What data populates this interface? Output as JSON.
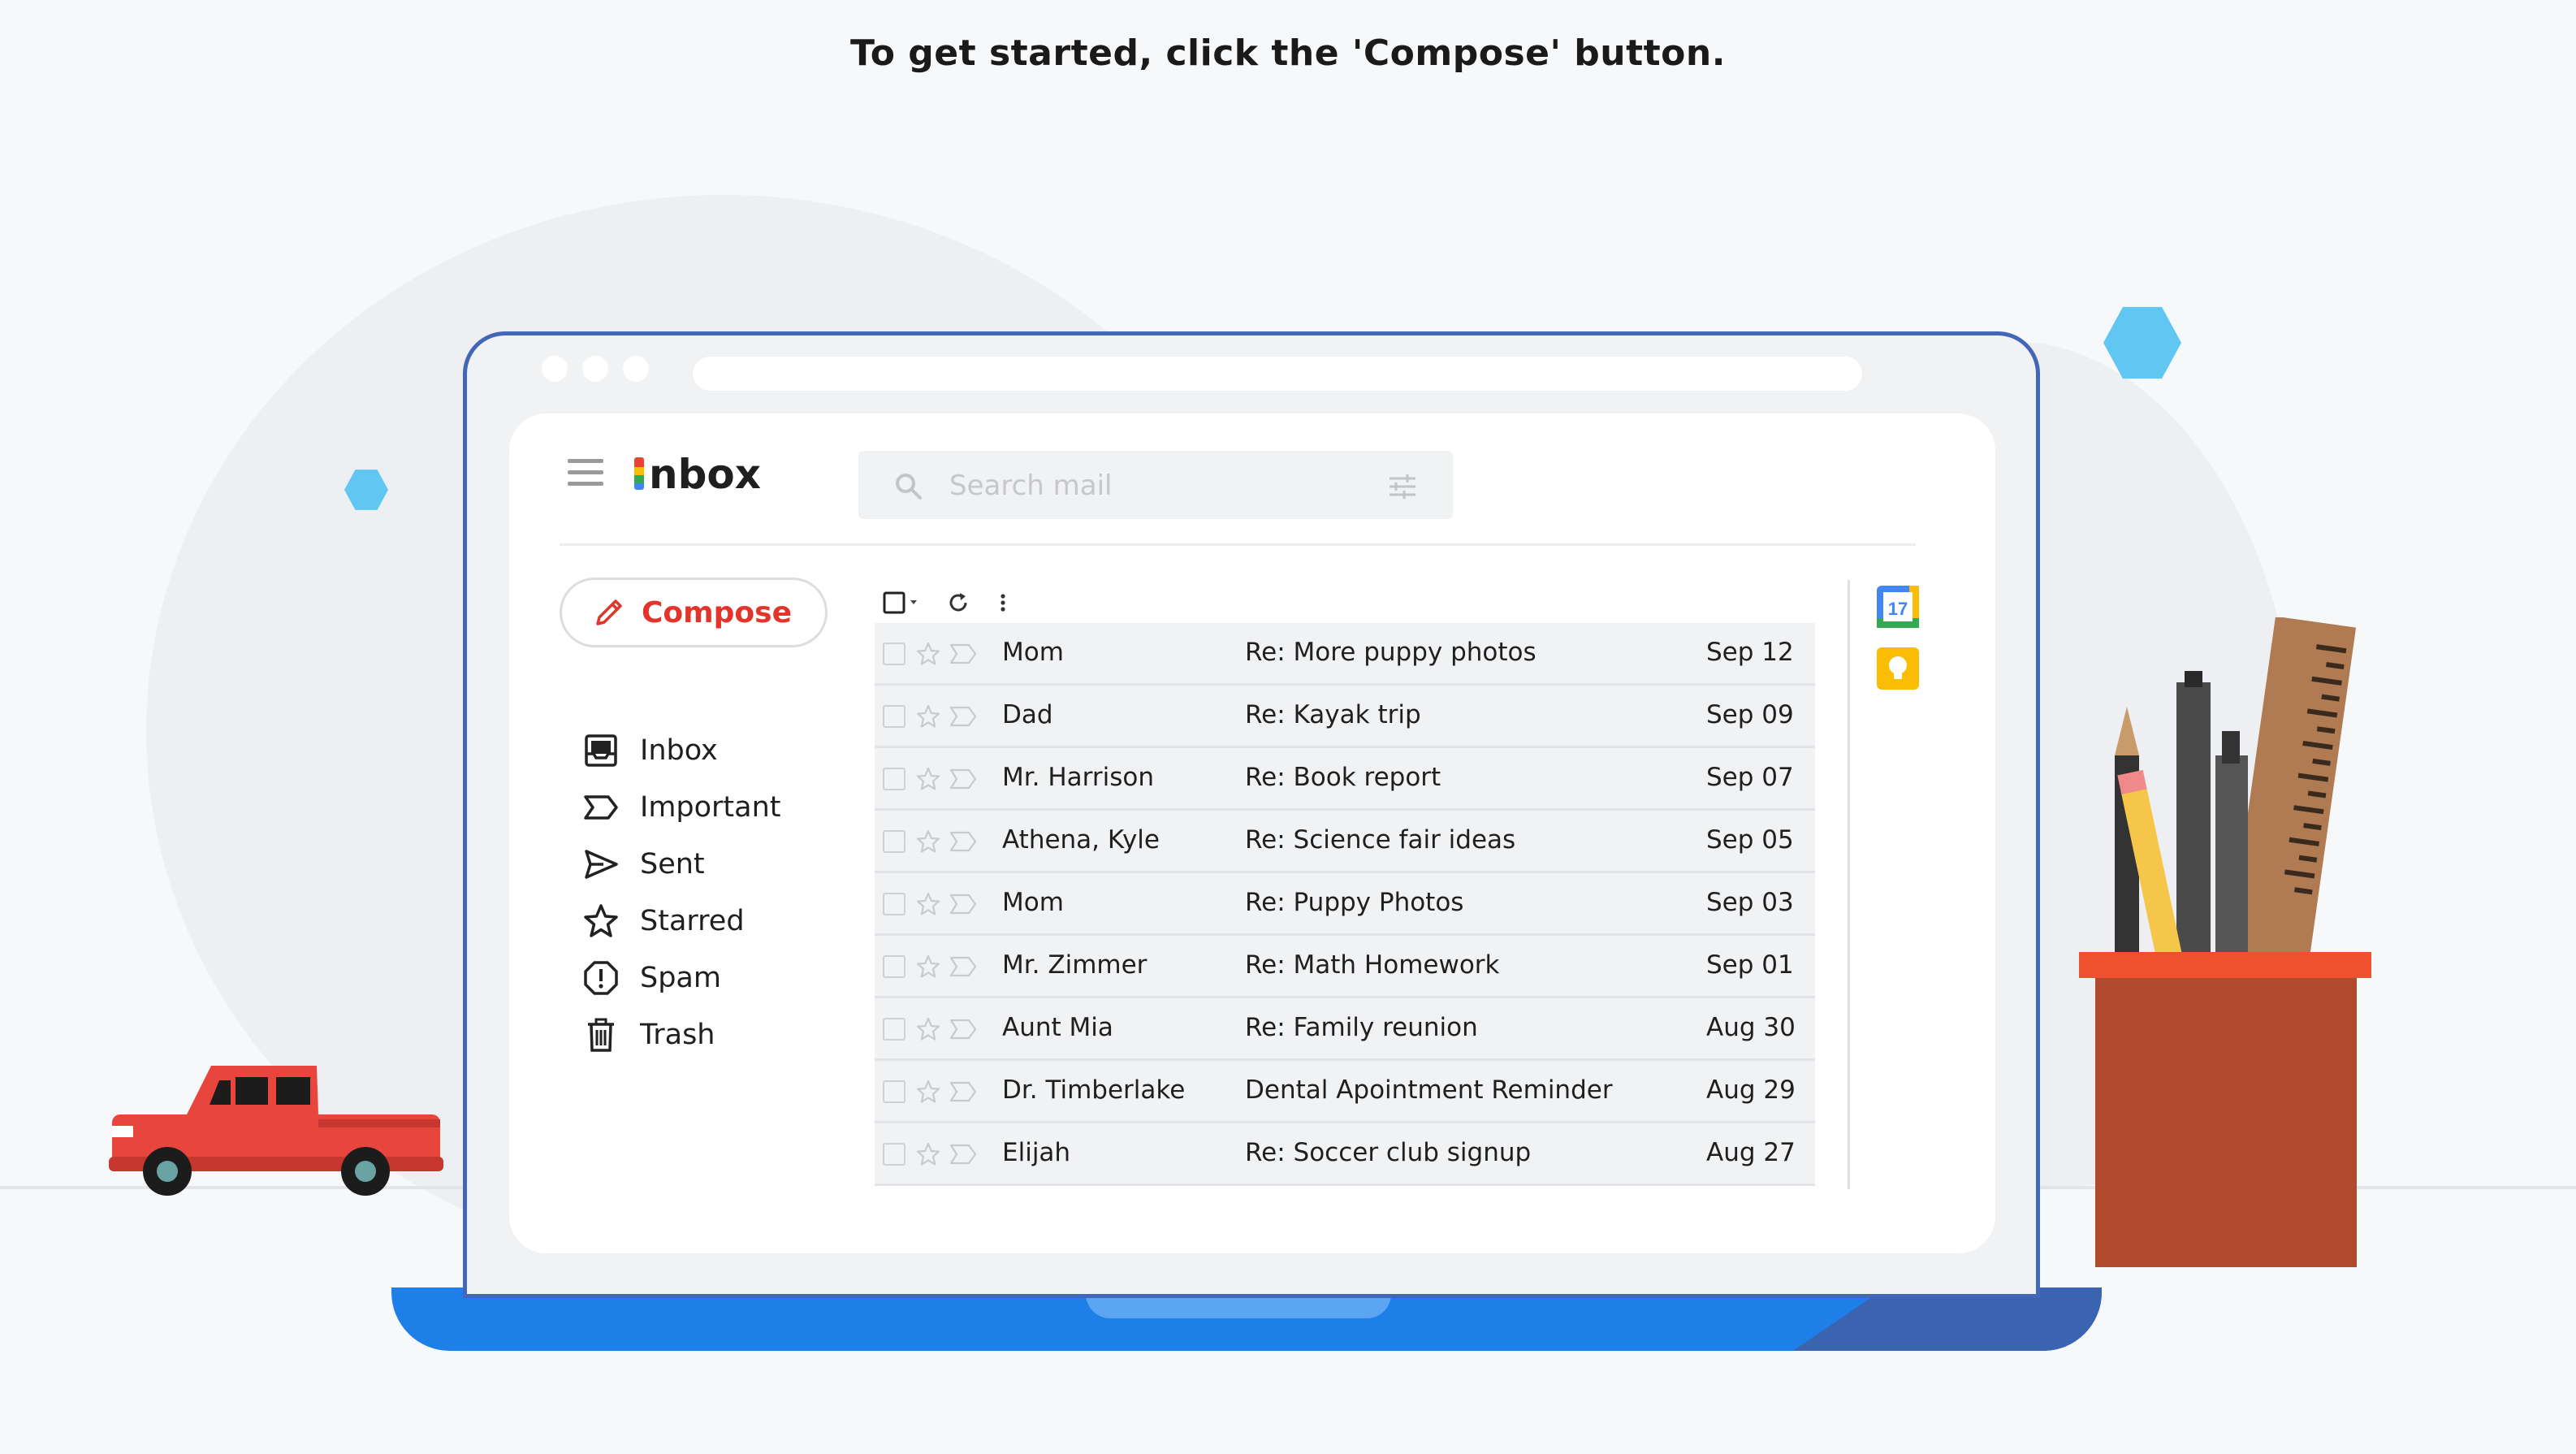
{
  "instruction": "To get started, click the 'Compose' button.",
  "app": {
    "logo_text": "nbox",
    "search_placeholder": "Search mail"
  },
  "compose": {
    "label": "Compose"
  },
  "nav": [
    {
      "label": "Inbox",
      "icon": "inbox-icon"
    },
    {
      "label": "Important",
      "icon": "important-icon"
    },
    {
      "label": "Sent",
      "icon": "send-icon"
    },
    {
      "label": "Starred",
      "icon": "star-icon"
    },
    {
      "label": "Spam",
      "icon": "spam-icon"
    },
    {
      "label": "Trash",
      "icon": "trash-icon"
    }
  ],
  "emails": [
    {
      "sender": "Mom",
      "subject": "Re: More puppy photos",
      "date": "Sep 12"
    },
    {
      "sender": "Dad",
      "subject": "Re: Kayak trip",
      "date": "Sep 09"
    },
    {
      "sender": "Mr. Harrison",
      "subject": "Re: Book report",
      "date": "Sep 07"
    },
    {
      "sender": "Athena, Kyle",
      "subject": "Re: Science fair ideas",
      "date": "Sep 05"
    },
    {
      "sender": "Mom",
      "subject": "Re: Puppy Photos",
      "date": "Sep 03"
    },
    {
      "sender": "Mr. Zimmer",
      "subject": "Re: Math Homework",
      "date": "Sep 01"
    },
    {
      "sender": "Aunt Mia",
      "subject": "Re: Family reunion",
      "date": "Aug 30"
    },
    {
      "sender": "Dr. Timberlake",
      "subject": "Dental Apointment Reminder",
      "date": "Aug 29"
    },
    {
      "sender": "Elijah",
      "subject": "Re: Soccer club signup",
      "date": "Aug 27"
    }
  ],
  "side_panel": {
    "calendar_day": "17"
  },
  "colors": {
    "compose_accent": "#e2342a",
    "laptop_frame": "#4466b8",
    "laptop_base": "#1f7fe8",
    "calendar_blue": "#4285f4",
    "keep_yellow": "#fbbc04"
  }
}
